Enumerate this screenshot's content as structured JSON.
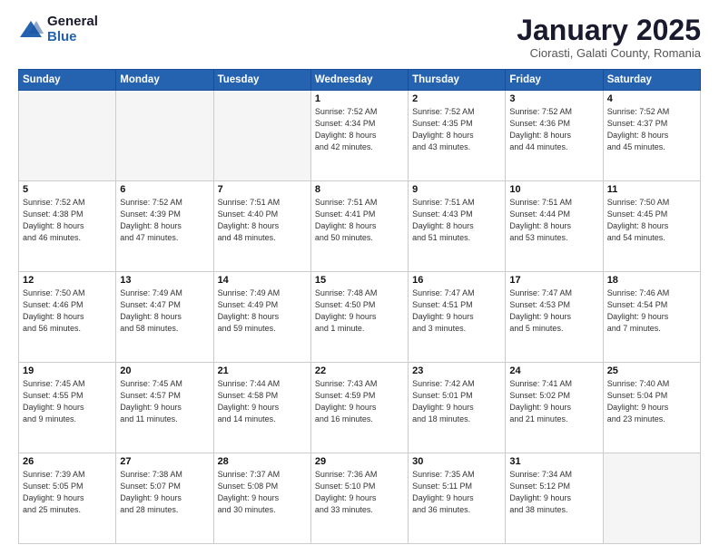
{
  "header": {
    "logo_general": "General",
    "logo_blue": "Blue",
    "month_title": "January 2025",
    "subtitle": "Ciorasti, Galati County, Romania"
  },
  "days_of_week": [
    "Sunday",
    "Monday",
    "Tuesday",
    "Wednesday",
    "Thursday",
    "Friday",
    "Saturday"
  ],
  "weeks": [
    [
      {
        "day": "",
        "empty": true
      },
      {
        "day": "",
        "empty": true
      },
      {
        "day": "",
        "empty": true
      },
      {
        "day": "1",
        "lines": [
          "Sunrise: 7:52 AM",
          "Sunset: 4:34 PM",
          "Daylight: 8 hours",
          "and 42 minutes."
        ]
      },
      {
        "day": "2",
        "lines": [
          "Sunrise: 7:52 AM",
          "Sunset: 4:35 PM",
          "Daylight: 8 hours",
          "and 43 minutes."
        ]
      },
      {
        "day": "3",
        "lines": [
          "Sunrise: 7:52 AM",
          "Sunset: 4:36 PM",
          "Daylight: 8 hours",
          "and 44 minutes."
        ]
      },
      {
        "day": "4",
        "lines": [
          "Sunrise: 7:52 AM",
          "Sunset: 4:37 PM",
          "Daylight: 8 hours",
          "and 45 minutes."
        ]
      }
    ],
    [
      {
        "day": "5",
        "lines": [
          "Sunrise: 7:52 AM",
          "Sunset: 4:38 PM",
          "Daylight: 8 hours",
          "and 46 minutes."
        ]
      },
      {
        "day": "6",
        "lines": [
          "Sunrise: 7:52 AM",
          "Sunset: 4:39 PM",
          "Daylight: 8 hours",
          "and 47 minutes."
        ]
      },
      {
        "day": "7",
        "lines": [
          "Sunrise: 7:51 AM",
          "Sunset: 4:40 PM",
          "Daylight: 8 hours",
          "and 48 minutes."
        ]
      },
      {
        "day": "8",
        "lines": [
          "Sunrise: 7:51 AM",
          "Sunset: 4:41 PM",
          "Daylight: 8 hours",
          "and 50 minutes."
        ]
      },
      {
        "day": "9",
        "lines": [
          "Sunrise: 7:51 AM",
          "Sunset: 4:43 PM",
          "Daylight: 8 hours",
          "and 51 minutes."
        ]
      },
      {
        "day": "10",
        "lines": [
          "Sunrise: 7:51 AM",
          "Sunset: 4:44 PM",
          "Daylight: 8 hours",
          "and 53 minutes."
        ]
      },
      {
        "day": "11",
        "lines": [
          "Sunrise: 7:50 AM",
          "Sunset: 4:45 PM",
          "Daylight: 8 hours",
          "and 54 minutes."
        ]
      }
    ],
    [
      {
        "day": "12",
        "lines": [
          "Sunrise: 7:50 AM",
          "Sunset: 4:46 PM",
          "Daylight: 8 hours",
          "and 56 minutes."
        ]
      },
      {
        "day": "13",
        "lines": [
          "Sunrise: 7:49 AM",
          "Sunset: 4:47 PM",
          "Daylight: 8 hours",
          "and 58 minutes."
        ]
      },
      {
        "day": "14",
        "lines": [
          "Sunrise: 7:49 AM",
          "Sunset: 4:49 PM",
          "Daylight: 8 hours",
          "and 59 minutes."
        ]
      },
      {
        "day": "15",
        "lines": [
          "Sunrise: 7:48 AM",
          "Sunset: 4:50 PM",
          "Daylight: 9 hours",
          "and 1 minute."
        ]
      },
      {
        "day": "16",
        "lines": [
          "Sunrise: 7:47 AM",
          "Sunset: 4:51 PM",
          "Daylight: 9 hours",
          "and 3 minutes."
        ]
      },
      {
        "day": "17",
        "lines": [
          "Sunrise: 7:47 AM",
          "Sunset: 4:53 PM",
          "Daylight: 9 hours",
          "and 5 minutes."
        ]
      },
      {
        "day": "18",
        "lines": [
          "Sunrise: 7:46 AM",
          "Sunset: 4:54 PM",
          "Daylight: 9 hours",
          "and 7 minutes."
        ]
      }
    ],
    [
      {
        "day": "19",
        "lines": [
          "Sunrise: 7:45 AM",
          "Sunset: 4:55 PM",
          "Daylight: 9 hours",
          "and 9 minutes."
        ]
      },
      {
        "day": "20",
        "lines": [
          "Sunrise: 7:45 AM",
          "Sunset: 4:57 PM",
          "Daylight: 9 hours",
          "and 11 minutes."
        ]
      },
      {
        "day": "21",
        "lines": [
          "Sunrise: 7:44 AM",
          "Sunset: 4:58 PM",
          "Daylight: 9 hours",
          "and 14 minutes."
        ]
      },
      {
        "day": "22",
        "lines": [
          "Sunrise: 7:43 AM",
          "Sunset: 4:59 PM",
          "Daylight: 9 hours",
          "and 16 minutes."
        ]
      },
      {
        "day": "23",
        "lines": [
          "Sunrise: 7:42 AM",
          "Sunset: 5:01 PM",
          "Daylight: 9 hours",
          "and 18 minutes."
        ]
      },
      {
        "day": "24",
        "lines": [
          "Sunrise: 7:41 AM",
          "Sunset: 5:02 PM",
          "Daylight: 9 hours",
          "and 21 minutes."
        ]
      },
      {
        "day": "25",
        "lines": [
          "Sunrise: 7:40 AM",
          "Sunset: 5:04 PM",
          "Daylight: 9 hours",
          "and 23 minutes."
        ]
      }
    ],
    [
      {
        "day": "26",
        "lines": [
          "Sunrise: 7:39 AM",
          "Sunset: 5:05 PM",
          "Daylight: 9 hours",
          "and 25 minutes."
        ]
      },
      {
        "day": "27",
        "lines": [
          "Sunrise: 7:38 AM",
          "Sunset: 5:07 PM",
          "Daylight: 9 hours",
          "and 28 minutes."
        ]
      },
      {
        "day": "28",
        "lines": [
          "Sunrise: 7:37 AM",
          "Sunset: 5:08 PM",
          "Daylight: 9 hours",
          "and 30 minutes."
        ]
      },
      {
        "day": "29",
        "lines": [
          "Sunrise: 7:36 AM",
          "Sunset: 5:10 PM",
          "Daylight: 9 hours",
          "and 33 minutes."
        ]
      },
      {
        "day": "30",
        "lines": [
          "Sunrise: 7:35 AM",
          "Sunset: 5:11 PM",
          "Daylight: 9 hours",
          "and 36 minutes."
        ]
      },
      {
        "day": "31",
        "lines": [
          "Sunrise: 7:34 AM",
          "Sunset: 5:12 PM",
          "Daylight: 9 hours",
          "and 38 minutes."
        ]
      },
      {
        "day": "",
        "empty": true
      }
    ]
  ]
}
